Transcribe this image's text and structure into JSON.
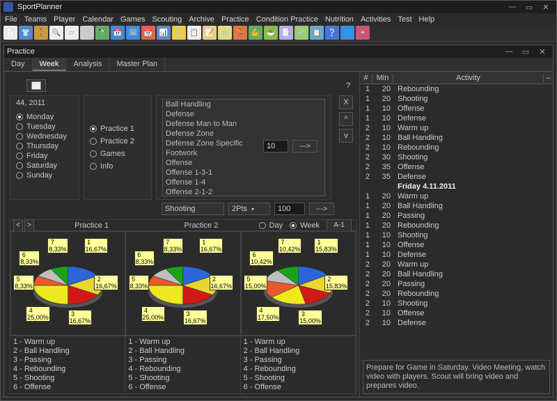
{
  "app": {
    "title": "SportPlanner"
  },
  "menus": [
    "File",
    "Teams",
    "Player",
    "Calendar",
    "Games",
    "Scouting",
    "Archive",
    "Practice",
    "Condition Practice",
    "Nutrition",
    "Activities",
    "Test",
    "Help"
  ],
  "toolbar_icons": [
    {
      "name": "new-file",
      "glyph": "📄",
      "bg": "#eeeeee"
    },
    {
      "name": "team",
      "glyph": "👕",
      "bg": "#5588cc"
    },
    {
      "name": "player",
      "glyph": "🧍",
      "bg": "#cc9944"
    },
    {
      "name": "search",
      "glyph": "🔍",
      "bg": "#eeeeee"
    },
    {
      "name": "swap",
      "glyph": "⇄",
      "bg": "#eeeeee"
    },
    {
      "name": "print",
      "glyph": "🖨",
      "bg": "#cccccc"
    },
    {
      "name": "scout",
      "glyph": "🔭",
      "bg": "#66aa66"
    },
    {
      "name": "calendar-1",
      "glyph": "📅",
      "bg": "#4488dd"
    },
    {
      "name": "calendar-2",
      "glyph": "🗓",
      "bg": "#4488dd"
    },
    {
      "name": "calendar-3",
      "glyph": "📆",
      "bg": "#dd6644"
    },
    {
      "name": "chart",
      "glyph": "📊",
      "bg": "#6688cc"
    },
    {
      "name": "week",
      "glyph": "🗒",
      "bg": "#eecc44"
    },
    {
      "name": "plan",
      "glyph": "📋",
      "bg": "#eeeeee"
    },
    {
      "name": "note",
      "glyph": "📝",
      "bg": "#eecc88"
    },
    {
      "name": "grid",
      "glyph": "▦",
      "bg": "#dddd77"
    },
    {
      "name": "practice",
      "glyph": "🏃",
      "bg": "#dd7744"
    },
    {
      "name": "cond",
      "glyph": "💪",
      "bg": "#66aa66"
    },
    {
      "name": "nutrition",
      "glyph": "🥗",
      "bg": "#88bb55"
    },
    {
      "name": "activity",
      "glyph": "📑",
      "bg": "#bbaaee"
    },
    {
      "name": "test",
      "glyph": "✔",
      "bg": "#99cc77"
    },
    {
      "name": "clipboard",
      "glyph": "📋",
      "bg": "#66aacc"
    },
    {
      "name": "help",
      "glyph": "❔",
      "bg": "#4477dd"
    },
    {
      "name": "globe",
      "glyph": "🌐",
      "bg": "#4488dd"
    },
    {
      "name": "about",
      "glyph": "✦",
      "bg": "#cc5577"
    }
  ],
  "subwindow": {
    "title": "Practice"
  },
  "tabs": [
    {
      "label": "Day",
      "active": false
    },
    {
      "label": "Week",
      "active": true
    },
    {
      "label": "Analysis",
      "active": false
    },
    {
      "label": "Master Plan",
      "active": false
    }
  ],
  "week_label": "44, 2011",
  "days": [
    {
      "label": "Monday",
      "checked": true
    },
    {
      "label": "Tuesday",
      "checked": false
    },
    {
      "label": "Wednesday",
      "checked": false
    },
    {
      "label": "Thursday",
      "checked": false
    },
    {
      "label": "Friday",
      "checked": false
    },
    {
      "label": "Saturday",
      "checked": false
    },
    {
      "label": "Sunday",
      "checked": false
    }
  ],
  "practice_types": [
    {
      "label": "Practice 1",
      "checked": true
    },
    {
      "label": "Practice 2",
      "checked": false
    },
    {
      "label": "Games",
      "checked": false
    },
    {
      "label": "Info",
      "checked": false
    }
  ],
  "activity_list": [
    "Ball Handling",
    "Defense",
    "Defense Man to Man",
    "Defense Zone",
    "Defense Zone Specific",
    "Footwork",
    "Offense",
    "Offense 1-3-1",
    "Offense 1-4",
    "Offense 2-1-2"
  ],
  "duration_input": "10",
  "assign_btn": "--->",
  "shooting_row": {
    "optionA": "Shooting",
    "optionB": "2Pts",
    "value": "100",
    "btn": "--->"
  },
  "side_buttons": [
    "X",
    "^",
    "v"
  ],
  "charts_hdr": {
    "titles": [
      "Practice 1",
      "Practice 2"
    ],
    "toggle": {
      "day": "Day",
      "week": "Week"
    },
    "abtn": "A-1"
  },
  "chart_data": [
    {
      "type": "pie",
      "title": "Practice 1",
      "series": [
        {
          "name": "",
          "values": [
            16.67,
            16.67,
            16.67,
            25.0,
            8.33,
            8.33,
            8.33
          ]
        }
      ],
      "labels": [
        {
          "n": "1",
          "v": "16,67%"
        },
        {
          "n": "2",
          "v": "16,67%"
        },
        {
          "n": "3",
          "v": "16,67%"
        },
        {
          "n": "4",
          "v": "25,00%"
        },
        {
          "n": "5",
          "v": "8,33%"
        },
        {
          "n": "6",
          "v": "8,33%"
        },
        {
          "n": "7",
          "v": "8,33%"
        }
      ],
      "colors": [
        "#2b65d9",
        "#e9d52e",
        "#d11919",
        "#ede91e",
        "#e9592e",
        "#bfbfbf",
        "#19a319"
      ]
    },
    {
      "type": "pie",
      "title": "Practice 2",
      "series": [
        {
          "name": "",
          "values": [
            16.67,
            16.67,
            16.67,
            25.0,
            8.33,
            8.33,
            8.33
          ]
        }
      ],
      "labels": [
        {
          "n": "1",
          "v": "16,67%"
        },
        {
          "n": "2",
          "v": "16,67%"
        },
        {
          "n": "3",
          "v": "16,67%"
        },
        {
          "n": "4",
          "v": "25,00%"
        },
        {
          "n": "5",
          "v": "8,33%"
        },
        {
          "n": "6",
          "v": "8,33%"
        },
        {
          "n": "7",
          "v": "8,33%"
        }
      ],
      "colors": [
        "#2b65d9",
        "#e9d52e",
        "#d11919",
        "#ede91e",
        "#e9592e",
        "#bfbfbf",
        "#19a319"
      ]
    },
    {
      "type": "pie",
      "title": "Week",
      "series": [
        {
          "name": "",
          "values": [
            15.83,
            15.83,
            15.0,
            17.5,
            15.0,
            10.42,
            10.42
          ]
        }
      ],
      "labels": [
        {
          "n": "1",
          "v": "15,83%"
        },
        {
          "n": "2",
          "v": "15,83%"
        },
        {
          "n": "3",
          "v": "15,00%"
        },
        {
          "n": "4",
          "v": "17,50%"
        },
        {
          "n": "5",
          "v": "15,00%"
        },
        {
          "n": "6",
          "v": "10,42%"
        },
        {
          "n": "7",
          "v": "10,42%"
        }
      ],
      "colors": [
        "#2b65d9",
        "#e9d52e",
        "#d11919",
        "#ede91e",
        "#e9592e",
        "#bfbfbf",
        "#19a319"
      ]
    }
  ],
  "legend_cols": [
    [
      "1 - Warm up",
      "2 - Ball Handling",
      "3 - Passing",
      "4 - Rebounding",
      "5 - Shooting",
      "6 - Offense"
    ],
    [
      "1 - Warm up",
      "2 - Ball Handling",
      "3 - Passing",
      "4 - Rebounding",
      "5 - Shooting",
      "6 - Offense"
    ],
    [
      "1 - Warm up",
      "2 - Ball Handling",
      "3 - Passing",
      "4 - Rebounding",
      "5 - Shooting",
      "6 - Offense"
    ]
  ],
  "rtable": {
    "headers": {
      "num": "#",
      "min": "Min",
      "activity": "Activity"
    },
    "rows": [
      {
        "n": "1",
        "m": "20",
        "a": "Rebounding"
      },
      {
        "n": "1",
        "m": "20",
        "a": "Shooting"
      },
      {
        "n": "1",
        "m": "10",
        "a": "Offense"
      },
      {
        "n": "1",
        "m": "10",
        "a": "Defense"
      },
      {
        "n": "2",
        "m": "10",
        "a": "Warm up"
      },
      {
        "n": "2",
        "m": "10",
        "a": "Ball Handling"
      },
      {
        "n": "2",
        "m": "10",
        "a": "Rebounding"
      },
      {
        "n": "2",
        "m": "30",
        "a": "Shooting"
      },
      {
        "n": "2",
        "m": "35",
        "a": "Offense"
      },
      {
        "n": "2",
        "m": "35",
        "a": "Defense"
      },
      {
        "section": true,
        "a": "Friday 4.11.2011"
      },
      {
        "n": "1",
        "m": "20",
        "a": "Warm up"
      },
      {
        "n": "1",
        "m": "20",
        "a": "Ball Handling"
      },
      {
        "n": "1",
        "m": "20",
        "a": "Passing"
      },
      {
        "n": "1",
        "m": "20",
        "a": "Rebounding"
      },
      {
        "n": "1",
        "m": "10",
        "a": "Shooting"
      },
      {
        "n": "1",
        "m": "10",
        "a": "Offense"
      },
      {
        "n": "1",
        "m": "10",
        "a": "Defense"
      },
      {
        "n": "2",
        "m": "20",
        "a": "Warm up"
      },
      {
        "n": "2",
        "m": "20",
        "a": "Ball Handling"
      },
      {
        "n": "2",
        "m": "20",
        "a": "Passing"
      },
      {
        "n": "2",
        "m": "20",
        "a": "Rebounding"
      },
      {
        "n": "2",
        "m": "10",
        "a": "Shooting"
      },
      {
        "n": "2",
        "m": "10",
        "a": "Offense"
      },
      {
        "n": "2",
        "m": "10",
        "a": "Defense"
      }
    ],
    "note": "Prepare for Game in Saturday. Video Meeting, watch video with players. Scout will bring video and prepares video."
  }
}
